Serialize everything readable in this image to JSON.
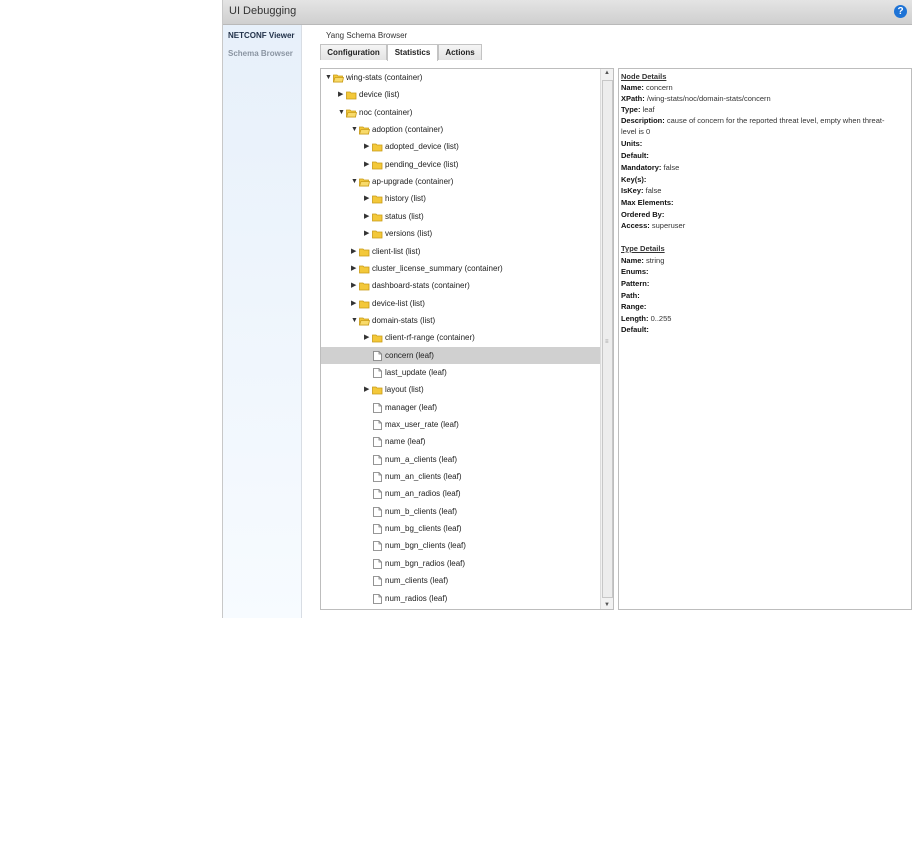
{
  "window": {
    "title": "UI Debugging",
    "help_label": "?"
  },
  "sidenav": {
    "items": [
      {
        "label": "NETCONF Viewer"
      },
      {
        "label": "Schema Browser"
      }
    ]
  },
  "panel": {
    "title": "Yang Schema Browser"
  },
  "tabs": [
    {
      "label": "Configuration"
    },
    {
      "label": "Statistics"
    },
    {
      "label": "Actions"
    }
  ],
  "tree": {
    "nodes": [
      {
        "label": "wing-stats (container)"
      },
      {
        "label": "device (list)"
      },
      {
        "label": "noc (container)"
      },
      {
        "label": "adoption (container)"
      },
      {
        "label": "adopted_device (list)"
      },
      {
        "label": "pending_device (list)"
      },
      {
        "label": "ap-upgrade (container)"
      },
      {
        "label": "history (list)"
      },
      {
        "label": "status (list)"
      },
      {
        "label": "versions (list)"
      },
      {
        "label": "client-list (list)"
      },
      {
        "label": "cluster_license_summary (container)"
      },
      {
        "label": "dashboard-stats (container)"
      },
      {
        "label": "device-list (list)"
      },
      {
        "label": "domain-stats (list)"
      },
      {
        "label": "client-rf-range (container)"
      },
      {
        "label": "concern (leaf)"
      },
      {
        "label": "last_update (leaf)"
      },
      {
        "label": "layout (list)"
      },
      {
        "label": "manager (leaf)"
      },
      {
        "label": "max_user_rate (leaf)"
      },
      {
        "label": "name (leaf)"
      },
      {
        "label": "num_a_clients (leaf)"
      },
      {
        "label": "num_an_clients (leaf)"
      },
      {
        "label": "num_an_radios (leaf)"
      },
      {
        "label": "num_b_clients (leaf)"
      },
      {
        "label": "num_bg_clients (leaf)"
      },
      {
        "label": "num_bgn_clients (leaf)"
      },
      {
        "label": "num_bgn_radios (leaf)"
      },
      {
        "label": "num_clients (leaf)"
      },
      {
        "label": "num_radios (leaf)"
      }
    ],
    "scroll_up": "▲",
    "scroll_down": "▼",
    "scroll_grip": "≡"
  },
  "node_details": {
    "heading": "Node Details",
    "name": {
      "k": "Name:",
      "v": "concern"
    },
    "xpath": {
      "k": "XPath:",
      "v": "/wing-stats/noc/domain-stats/concern"
    },
    "type": {
      "k": "Type:",
      "v": "leaf"
    },
    "description": {
      "k": "Description:",
      "v": "cause of concern for the reported threat level, empty when threat-",
      "v2": "level is 0"
    },
    "units": {
      "k": "Units:",
      "v": ""
    },
    "default": {
      "k": "Default:",
      "v": ""
    },
    "mandatory": {
      "k": "Mandatory:",
      "v": "false"
    },
    "keys": {
      "k": "Key(s):",
      "v": ""
    },
    "iskey": {
      "k": "IsKey:",
      "v": "false"
    },
    "max_elements": {
      "k": "Max Elements:",
      "v": ""
    },
    "ordered_by": {
      "k": "Ordered By:",
      "v": ""
    },
    "access": {
      "k": "Access:",
      "v": "superuser"
    }
  },
  "type_details": {
    "heading": "Type Details",
    "name": {
      "k": "Name:",
      "v": "string"
    },
    "enums": {
      "k": "Enums:",
      "v": ""
    },
    "pattern": {
      "k": "Pattern:",
      "v": ""
    },
    "path": {
      "k": "Path:",
      "v": ""
    },
    "range": {
      "k": "Range:",
      "v": ""
    },
    "length": {
      "k": "Length:",
      "v": "0..255"
    },
    "default": {
      "k": "Default:",
      "v": ""
    }
  },
  "colors": {
    "folder": "#f3c83a",
    "folder_edge": "#c99a16",
    "selected_row": "#d0d0d0",
    "help": "#1e73d6"
  }
}
